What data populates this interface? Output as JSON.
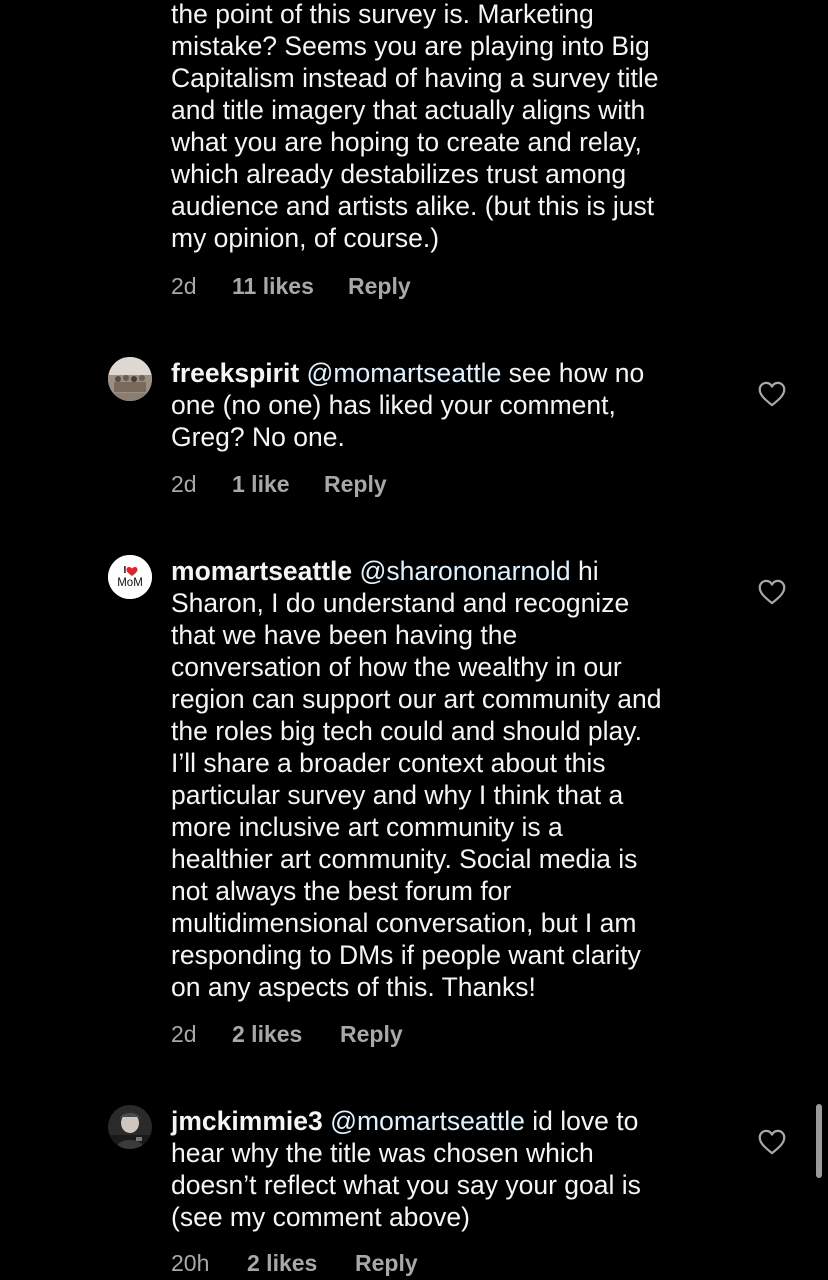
{
  "comments": [
    {
      "text": "the point of this survey is. Marketing\nmistake? Seems you are playing into Big\nCapitalism instead of having a survey title\nand title imagery that actually aligns with\nwhat you are hoping to create and relay,\nwhich already destabilizes trust among\naudience and artists alike. (but this is just\nmy opinion, of course.)",
      "time": "2d",
      "likes": "11 likes",
      "reply": "Reply"
    },
    {
      "username": "freekspirit",
      "mention": "@momartseattle",
      "text_first": " see how no",
      "text_rest": "one (no one) has liked your comment,\nGreg? No one.",
      "time": "2d",
      "likes": "1 like",
      "reply": "Reply",
      "avatar": "group-photo-avatar"
    },
    {
      "username": "momartseattle",
      "mention": "@sharononarnold",
      "text_first": " hi",
      "text_rest": "Sharon, I do understand and recognize\nthat we have been having the\nconversation of how the wealthy in our\nregion can support our art community and\nthe roles big tech could and should play.\nI’ll share a broader context about this\nparticular survey and why I think that a\nmore inclusive art community is a\nhealthier art community. Social media is\nnot always the best forum for\nmultidimensional conversation, but I am\nresponding to DMs if people want clarity\non any aspects of this. Thanks!",
      "time": "2d",
      "likes": "2 likes",
      "reply": "Reply",
      "avatar_text": "MoM",
      "avatar_accent": "#e0242b"
    },
    {
      "username": "jmckimmie3",
      "mention": "@momartseattle",
      "text_first": " id love to",
      "text_rest": "hear why the title was chosen which\ndoesn’t reflect what you say your goal is\n(see my comment above)",
      "time": "20h",
      "likes": "2 likes",
      "reply": "Reply",
      "avatar": "person-photo-avatar"
    }
  ],
  "colors": {
    "background": "#000000",
    "text": "#f5f5f5",
    "meta": "#a8a8a8",
    "mention": "#e0f1ff"
  }
}
